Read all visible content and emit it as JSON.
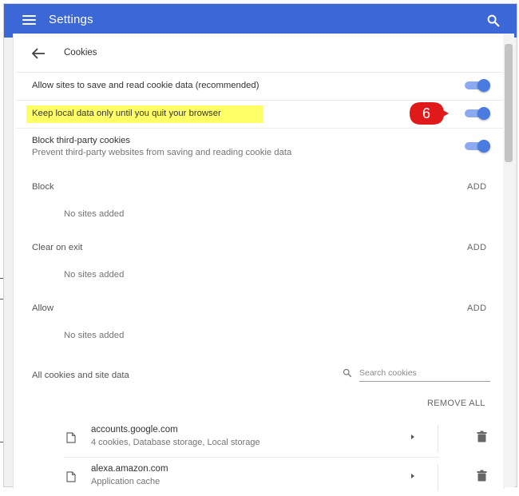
{
  "topbar": {
    "menu_icon": "hamburger-menu-icon",
    "title": "Settings",
    "search_icon": "search-icon"
  },
  "page": {
    "back_icon": "arrow-back-icon",
    "title": "Cookies"
  },
  "settings": [
    {
      "label": "Allow sites to save and read cookie data (recommended)",
      "enabled": true
    },
    {
      "label": "Keep local data only until you quit your browser",
      "enabled": true,
      "highlighted": true,
      "callout": "6",
      "highlight_color": "#ffff66",
      "callout_color": "#e01a1a"
    },
    {
      "label": "Block third-party cookies",
      "sub": "Prevent third-party websites from saving and reading cookie data",
      "enabled": true
    }
  ],
  "sections": [
    {
      "label": "Block",
      "action": "ADD",
      "empty": "No sites added"
    },
    {
      "label": "Clear on exit",
      "action": "ADD",
      "empty": "No sites added"
    },
    {
      "label": "Allow",
      "action": "ADD",
      "empty": "No sites added"
    }
  ],
  "all_cookies": {
    "label": "All cookies and site data",
    "search_placeholder": "Search cookies",
    "remove_all": "REMOVE ALL",
    "sites": [
      {
        "name": "accounts.google.com",
        "details": "4 cookies, Database storage, Local storage"
      },
      {
        "name": "alexa.amazon.com",
        "details": "Application cache"
      }
    ]
  },
  "colors": {
    "accent": "#3c67d7",
    "toggle_on": "#4a7be0",
    "toggle_track": "#8caaf0"
  }
}
